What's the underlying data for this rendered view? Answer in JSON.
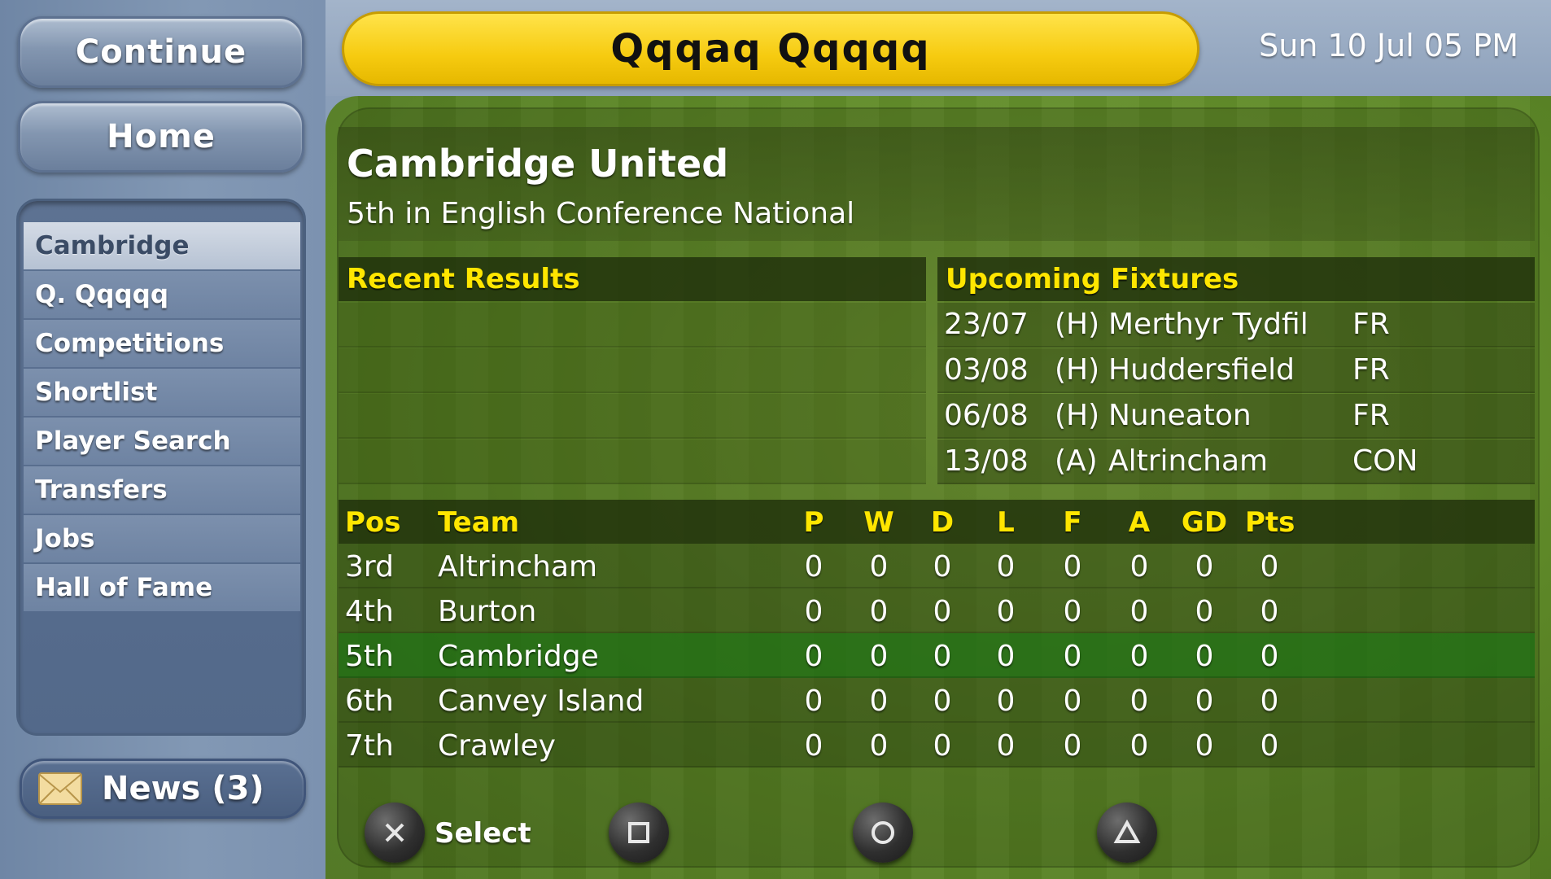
{
  "sidebar": {
    "continue_label": "Continue",
    "home_label": "Home",
    "items": [
      {
        "label": "Cambridge",
        "active": true
      },
      {
        "label": "Q. Qqqqq"
      },
      {
        "label": "Competitions"
      },
      {
        "label": "Shortlist"
      },
      {
        "label": "Player Search"
      },
      {
        "label": "Transfers"
      },
      {
        "label": "Jobs"
      },
      {
        "label": "Hall of Fame"
      }
    ],
    "news_label": "News (3)"
  },
  "header": {
    "title": "Qqqaq Qqqqq",
    "datetime": "Sun 10 Jul 05 PM"
  },
  "club": {
    "name": "Cambridge United",
    "standing": "5th in English Conference National"
  },
  "recent_results": {
    "title": "Recent Results"
  },
  "upcoming_fixtures": {
    "title": "Upcoming Fixtures",
    "rows": [
      {
        "date": "23/07",
        "venue": "(H)",
        "opponent": "Merthyr Tydfil",
        "competition": "FR"
      },
      {
        "date": "03/08",
        "venue": "(H)",
        "opponent": "Huddersfield",
        "competition": "FR"
      },
      {
        "date": "06/08",
        "venue": "(H)",
        "opponent": "Nuneaton",
        "competition": "FR"
      },
      {
        "date": "13/08",
        "venue": "(A)",
        "opponent": "Altrincham",
        "competition": "CON"
      }
    ]
  },
  "league_table": {
    "headers": {
      "pos": "Pos",
      "team": "Team",
      "p": "P",
      "w": "W",
      "d": "D",
      "l": "L",
      "f": "F",
      "a": "A",
      "gd": "GD",
      "pts": "Pts"
    },
    "rows": [
      {
        "pos": "3rd",
        "team": "Altrincham",
        "p": "0",
        "w": "0",
        "d": "0",
        "l": "0",
        "f": "0",
        "a": "0",
        "gd": "0",
        "pts": "0"
      },
      {
        "pos": "4th",
        "team": "Burton",
        "p": "0",
        "w": "0",
        "d": "0",
        "l": "0",
        "f": "0",
        "a": "0",
        "gd": "0",
        "pts": "0"
      },
      {
        "pos": "5th",
        "team": "Cambridge",
        "p": "0",
        "w": "0",
        "d": "0",
        "l": "0",
        "f": "0",
        "a": "0",
        "gd": "0",
        "pts": "0",
        "highlight": true
      },
      {
        "pos": "6th",
        "team": "Canvey Island",
        "p": "0",
        "w": "0",
        "d": "0",
        "l": "0",
        "f": "0",
        "a": "0",
        "gd": "0",
        "pts": "0"
      },
      {
        "pos": "7th",
        "team": "Crawley",
        "p": "0",
        "w": "0",
        "d": "0",
        "l": "0",
        "f": "0",
        "a": "0",
        "gd": "0",
        "pts": "0"
      }
    ]
  },
  "controls": {
    "select_label": "Select",
    "icons": [
      "cross-button-icon",
      "square-button-icon",
      "circle-button-icon",
      "triangle-button-icon"
    ]
  },
  "colors": {
    "title_pill": "#f6cb10",
    "header_text": "#ffe600",
    "highlight_row": "#1e6e14",
    "sidebar": "#7c92b0"
  }
}
